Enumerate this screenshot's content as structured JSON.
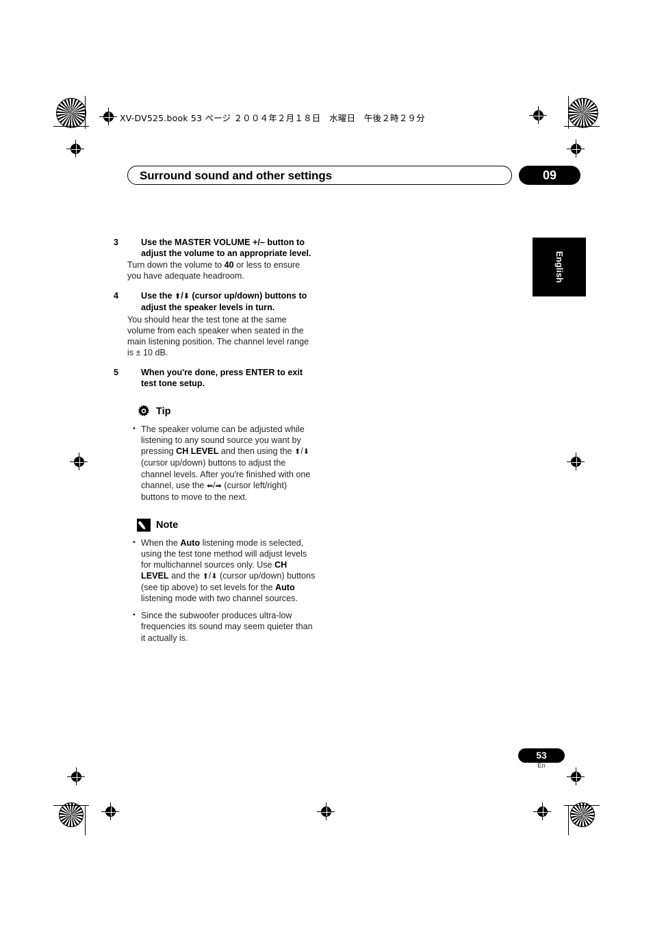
{
  "header": {
    "booktag": "XV-DV525.book  53 ページ  ２００４年２月１８日　水曜日　午後２時２９分"
  },
  "chapter": {
    "title": "Surround sound and other settings",
    "number": "09",
    "side_tab": "English"
  },
  "steps": [
    {
      "num": "3",
      "heading": "Use the MASTER VOLUME +/– button to adjust the volume to an appropriate level.",
      "body_1": "Turn down the volume to ",
      "body_bold": "40",
      "body_2": " or less to ensure you have adequate headroom."
    },
    {
      "num": "4",
      "heading_pre": "Use the ",
      "heading_post": " (cursor up/down) buttons to adjust the speaker levels in turn.",
      "body": "You should hear the test tone at the same volume from each speaker when seated in the main listening position. The channel level range is ± 10 dB."
    },
    {
      "num": "5",
      "heading": "When you're done, press ENTER to exit test tone setup."
    }
  ],
  "tip": {
    "label": "Tip",
    "icon": "gear-icon",
    "items": [
      {
        "t1": "The speaker volume can be adjusted while listening to any sound source you want by pressing ",
        "b1": "CH LEVEL",
        "t2": " and then using the ",
        "t3": " (cursor up/down) buttons to adjust the channel levels. After you're finished with one channel, use the ",
        "t4": " (cursor left/right) buttons to move to the next."
      }
    ]
  },
  "note": {
    "label": "Note",
    "icon": "pencil-icon",
    "items": [
      {
        "t1": "When the ",
        "b1": "Auto",
        "t2": " listening mode is selected, using the test tone method will adjust levels for multichannel sources only. Use ",
        "b2": "CH LEVEL",
        "t3": " and the ",
        "t4": " (cursor up/down) buttons (see tip above) to set levels for the ",
        "b3": "Auto",
        "t5": " listening mode with two channel sources."
      },
      {
        "t1": "Since the subwoofer produces ultra-low frequencies its sound may seem quieter than it actually is."
      }
    ]
  },
  "footer": {
    "page_number": "53",
    "language_code": "En"
  },
  "glyphs": {
    "up": "⬆",
    "down": "⬇",
    "left": "⬅",
    "right": "➡",
    "slash": "/"
  },
  "colors": {
    "ink": "#231f20",
    "black": "#000000",
    "paper": "#ffffff"
  }
}
